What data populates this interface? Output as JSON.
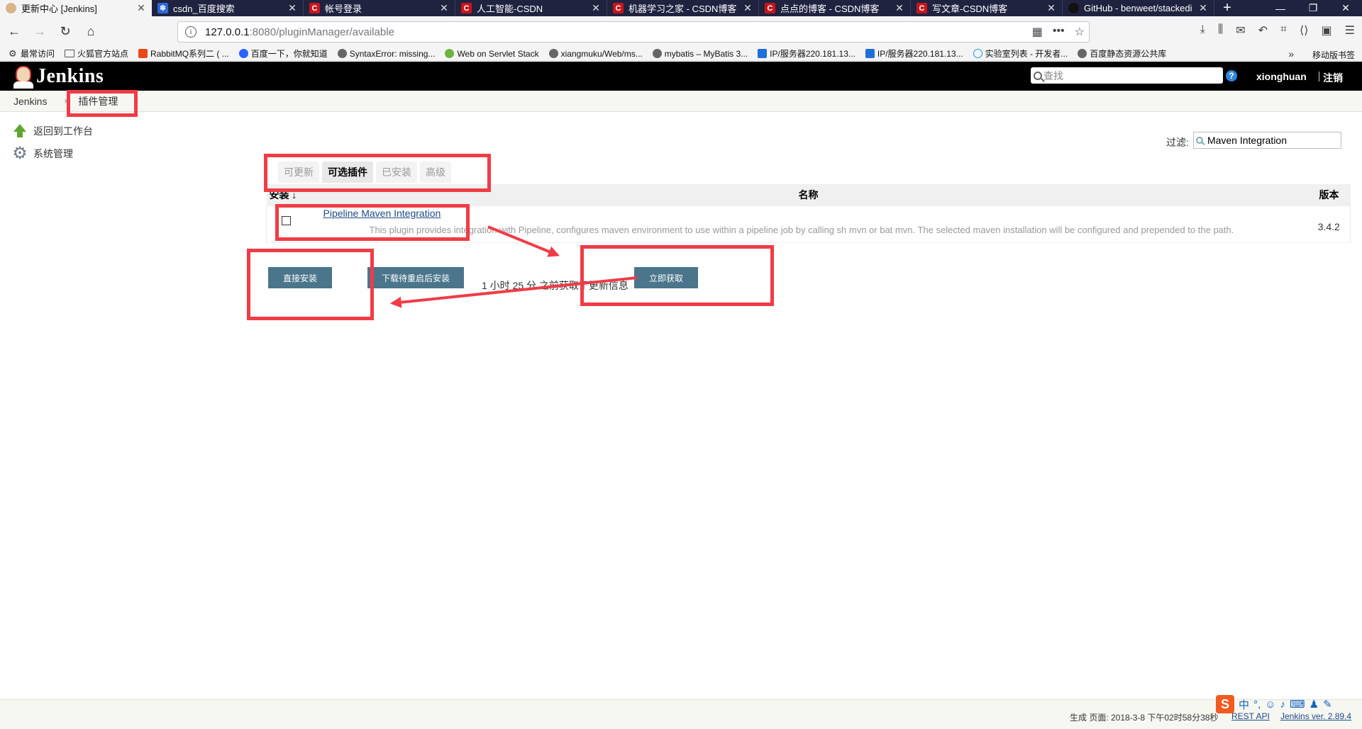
{
  "browser": {
    "tabs": [
      {
        "label": "更新中心 [Jenkins]",
        "icon": "jenkins-icon",
        "active": true
      },
      {
        "label": "csdn_百度搜索",
        "icon": "baidu-icon",
        "active": false
      },
      {
        "label": "帐号登录",
        "icon": "csdn-icon",
        "active": false
      },
      {
        "label": "人工智能-CSDN",
        "icon": "csdn-icon",
        "active": false
      },
      {
        "label": "机器学习之家 - CSDN博客",
        "icon": "csdn-icon",
        "active": false
      },
      {
        "label": "点点的博客 - CSDN博客",
        "icon": "csdn-icon",
        "active": false
      },
      {
        "label": "写文章-CSDN博客",
        "icon": "csdn-icon",
        "active": false
      },
      {
        "label": "GitHub - benweet/stackedi",
        "icon": "github-icon",
        "active": false
      }
    ],
    "url_host": "127.0.0.1",
    "url_path": ":8080/pluginManager/available",
    "bookmarks": [
      {
        "label": "最常访问",
        "icon": "gear-icon"
      },
      {
        "label": "火狐官方站点",
        "icon": "folder-icon"
      },
      {
        "label": "RabbitMQ系列二 ( ...",
        "icon": "fire-icon"
      },
      {
        "label": "百度一下，你就知道",
        "icon": "paw-icon"
      },
      {
        "label": "SyntaxError: missing...",
        "icon": "globe-icon"
      },
      {
        "label": "Web on Servlet Stack",
        "icon": "leaf-icon"
      },
      {
        "label": "xiangmuku/Web/ms...",
        "icon": "globe-icon"
      },
      {
        "label": "mybatis – MyBatis 3...",
        "icon": "globe-icon"
      },
      {
        "label": "IP/服务器220.181.13...",
        "icon": "ip-icon"
      },
      {
        "label": "IP/服务器220.181.13...",
        "icon": "ip-icon"
      },
      {
        "label": "实验室列表 - 开发者...",
        "icon": "cloud-icon"
      },
      {
        "label": "百度静态资源公共库",
        "icon": "globe-icon"
      }
    ],
    "bookmarks_mobile": "移动版书签"
  },
  "jenkins": {
    "logo_text": "Jenkins",
    "search_placeholder": "查找",
    "user": "xionghuan",
    "logout": "注销",
    "breadcrumb": [
      "Jenkins",
      "插件管理"
    ],
    "tasks": [
      {
        "label": "返回到工作台",
        "icon": "arrow-up-icon"
      },
      {
        "label": "系统管理",
        "icon": "gear-icon"
      }
    ],
    "filter_label": "过滤:",
    "filter_value": "Maven Integration",
    "tabs": [
      {
        "label": "可更新",
        "active": false
      },
      {
        "label": "可选插件",
        "active": true
      },
      {
        "label": "已安装",
        "active": false
      },
      {
        "label": "高级",
        "active": false
      }
    ],
    "table": {
      "headers": {
        "install": "安装 ↓",
        "name": "名称",
        "version": "版本"
      },
      "rows": [
        {
          "checked": false,
          "name": "Pipeline Maven Integration",
          "description": "This plugin provides integration with Pipeline, configures maven environment to use within a pipeline job by calling sh mvn or bat mvn. The selected maven installation will be configured and prepended to the path.",
          "version": "3.4.2"
        }
      ]
    },
    "buttons": {
      "install": "直接安装",
      "download": "下载待重启后安装",
      "check": "立即获取"
    },
    "update_info": "1 小时 25 分 之前获取了更新信息",
    "footer": {
      "generated": "生成 页面: 2018-3-8 下午02时58分38秒",
      "rest_api": "REST API",
      "version": "Jenkins ver. 2.89.4"
    }
  },
  "annotation_color": "#f03c46"
}
